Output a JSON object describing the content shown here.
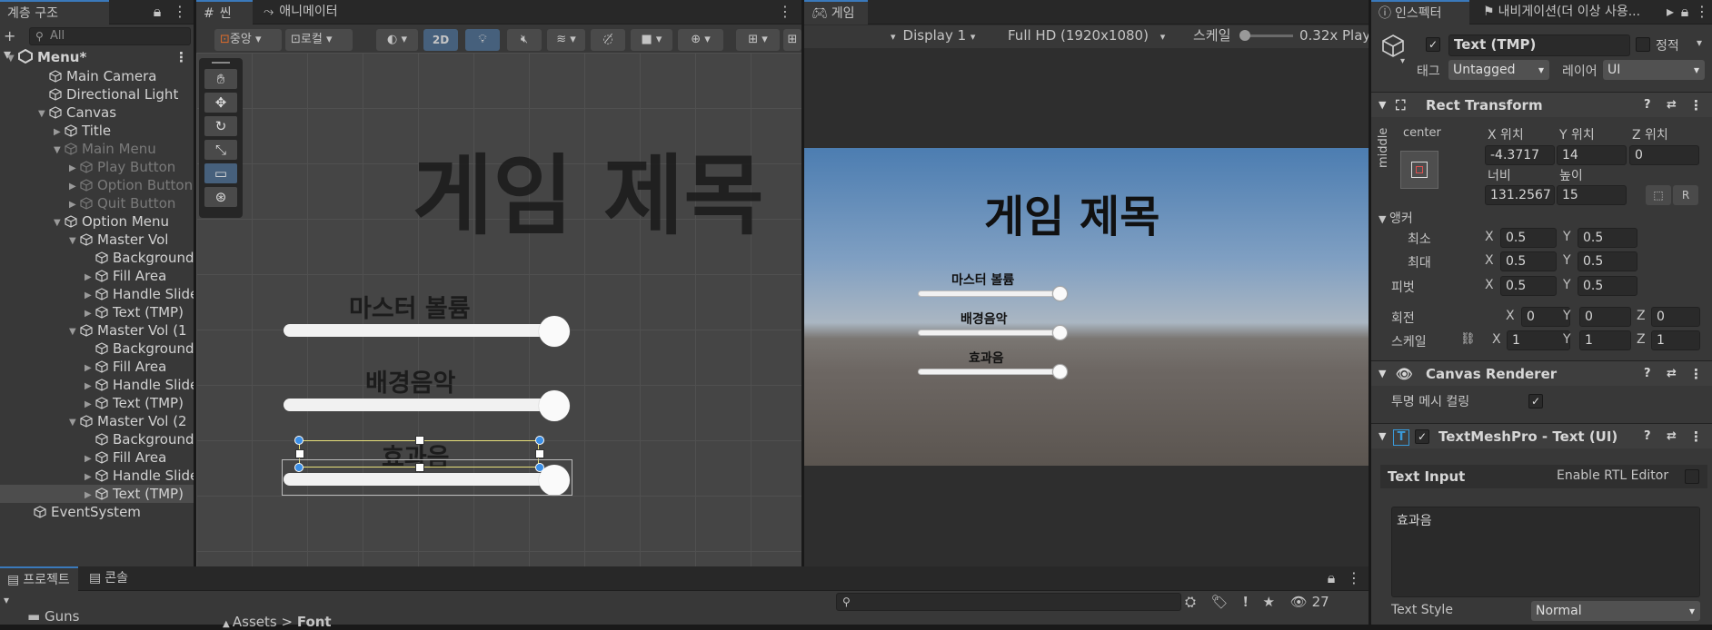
{
  "hierarchy": {
    "tab": "계층 구조",
    "search_placeholder": "All",
    "scene_name": "Menu*",
    "rows": [
      {
        "label": "Main Camera"
      },
      {
        "label": "Directional Light"
      },
      {
        "label": "Canvas"
      },
      {
        "label": "Title"
      },
      {
        "label": "Main Menu"
      },
      {
        "label": "Play Button"
      },
      {
        "label": "Option Button"
      },
      {
        "label": "Quit Button"
      },
      {
        "label": "Option Menu"
      },
      {
        "label": "Master Vol"
      },
      {
        "label": "Background"
      },
      {
        "label": "Fill Area"
      },
      {
        "label": "Handle Slide"
      },
      {
        "label": "Text (TMP)"
      },
      {
        "label": "Master Vol (1"
      },
      {
        "label": "Background"
      },
      {
        "label": "Fill Area"
      },
      {
        "label": "Handle Slide"
      },
      {
        "label": "Text (TMP)"
      },
      {
        "label": "Master Vol (2"
      },
      {
        "label": "Background"
      },
      {
        "label": "Fill Area"
      },
      {
        "label": "Handle Slide"
      },
      {
        "label": "Text (TMP)"
      },
      {
        "label": "EventSystem"
      }
    ]
  },
  "scene": {
    "tab_scene": "씬",
    "tab_animator": "애니메이터",
    "pivot_label": "중앙",
    "space_label": "로컬",
    "mode_2d": "2D",
    "title_text": "게임 제목",
    "labels": [
      "마스터 볼륨",
      "배경음악",
      "효과음"
    ]
  },
  "game": {
    "tab": "게임",
    "display": "Display 1",
    "resolution": "Full HD (1920x1080)",
    "scale_label": "스케일",
    "scale_value": "0.32x",
    "play_label": "Play F",
    "title_text": "게임 제목",
    "labels": [
      "마스터 볼륨",
      "배경음악",
      "효과음"
    ]
  },
  "inspector": {
    "tab_inspector": "인스펙터",
    "tab_nav": "내비게이션(더 이상 사용...",
    "object_name": "Text (TMP)",
    "static_label": "정적",
    "tag_label": "태그",
    "tag_value": "Untagged",
    "layer_label": "레이어",
    "layer_value": "UI",
    "rect_transform": {
      "title": "Rect Transform",
      "anchor_h": "center",
      "anchor_v": "middle",
      "pos_x_label": "X 위치",
      "pos_x": "-4.3717",
      "pos_y_label": "Y 위치",
      "pos_y": "14",
      "pos_z_label": "Z 위치",
      "pos_z": "0",
      "width_label": "너비",
      "width": "131.2567",
      "height_label": "높이",
      "height": "15",
      "raw_btn": "R",
      "anchors_label": "앵커",
      "min_label": "최소",
      "min_x": "0.5",
      "min_y": "0.5",
      "max_label": "최대",
      "max_x": "0.5",
      "max_y": "0.5",
      "pivot_label": "피벗",
      "pivot_x": "0.5",
      "pivot_y": "0.5",
      "rotation_label": "회전",
      "rot_x": "0",
      "rot_y": "0",
      "rot_z": "0",
      "scale_label": "스케일",
      "scale_x": "1",
      "scale_y": "1",
      "scale_z": "1",
      "x": "X",
      "y": "Y",
      "z": "Z"
    },
    "canvas_renderer": {
      "title": "Canvas Renderer",
      "cull_label": "투명 메시 컬링"
    },
    "tmp": {
      "title": "TextMeshPro - Text (UI)",
      "text_input_label": "Text Input",
      "rtl_label": "Enable RTL Editor",
      "text_value": "효과음",
      "text_style_label": "Text Style",
      "text_style_value": "Normal"
    }
  },
  "bottom": {
    "tab_project": "프로젝트",
    "tab_console": "콘솔",
    "folder": "Guns",
    "breadcrumb_root": "Assets",
    "breadcrumb_leaf": "Font",
    "hidden_count": "27"
  }
}
